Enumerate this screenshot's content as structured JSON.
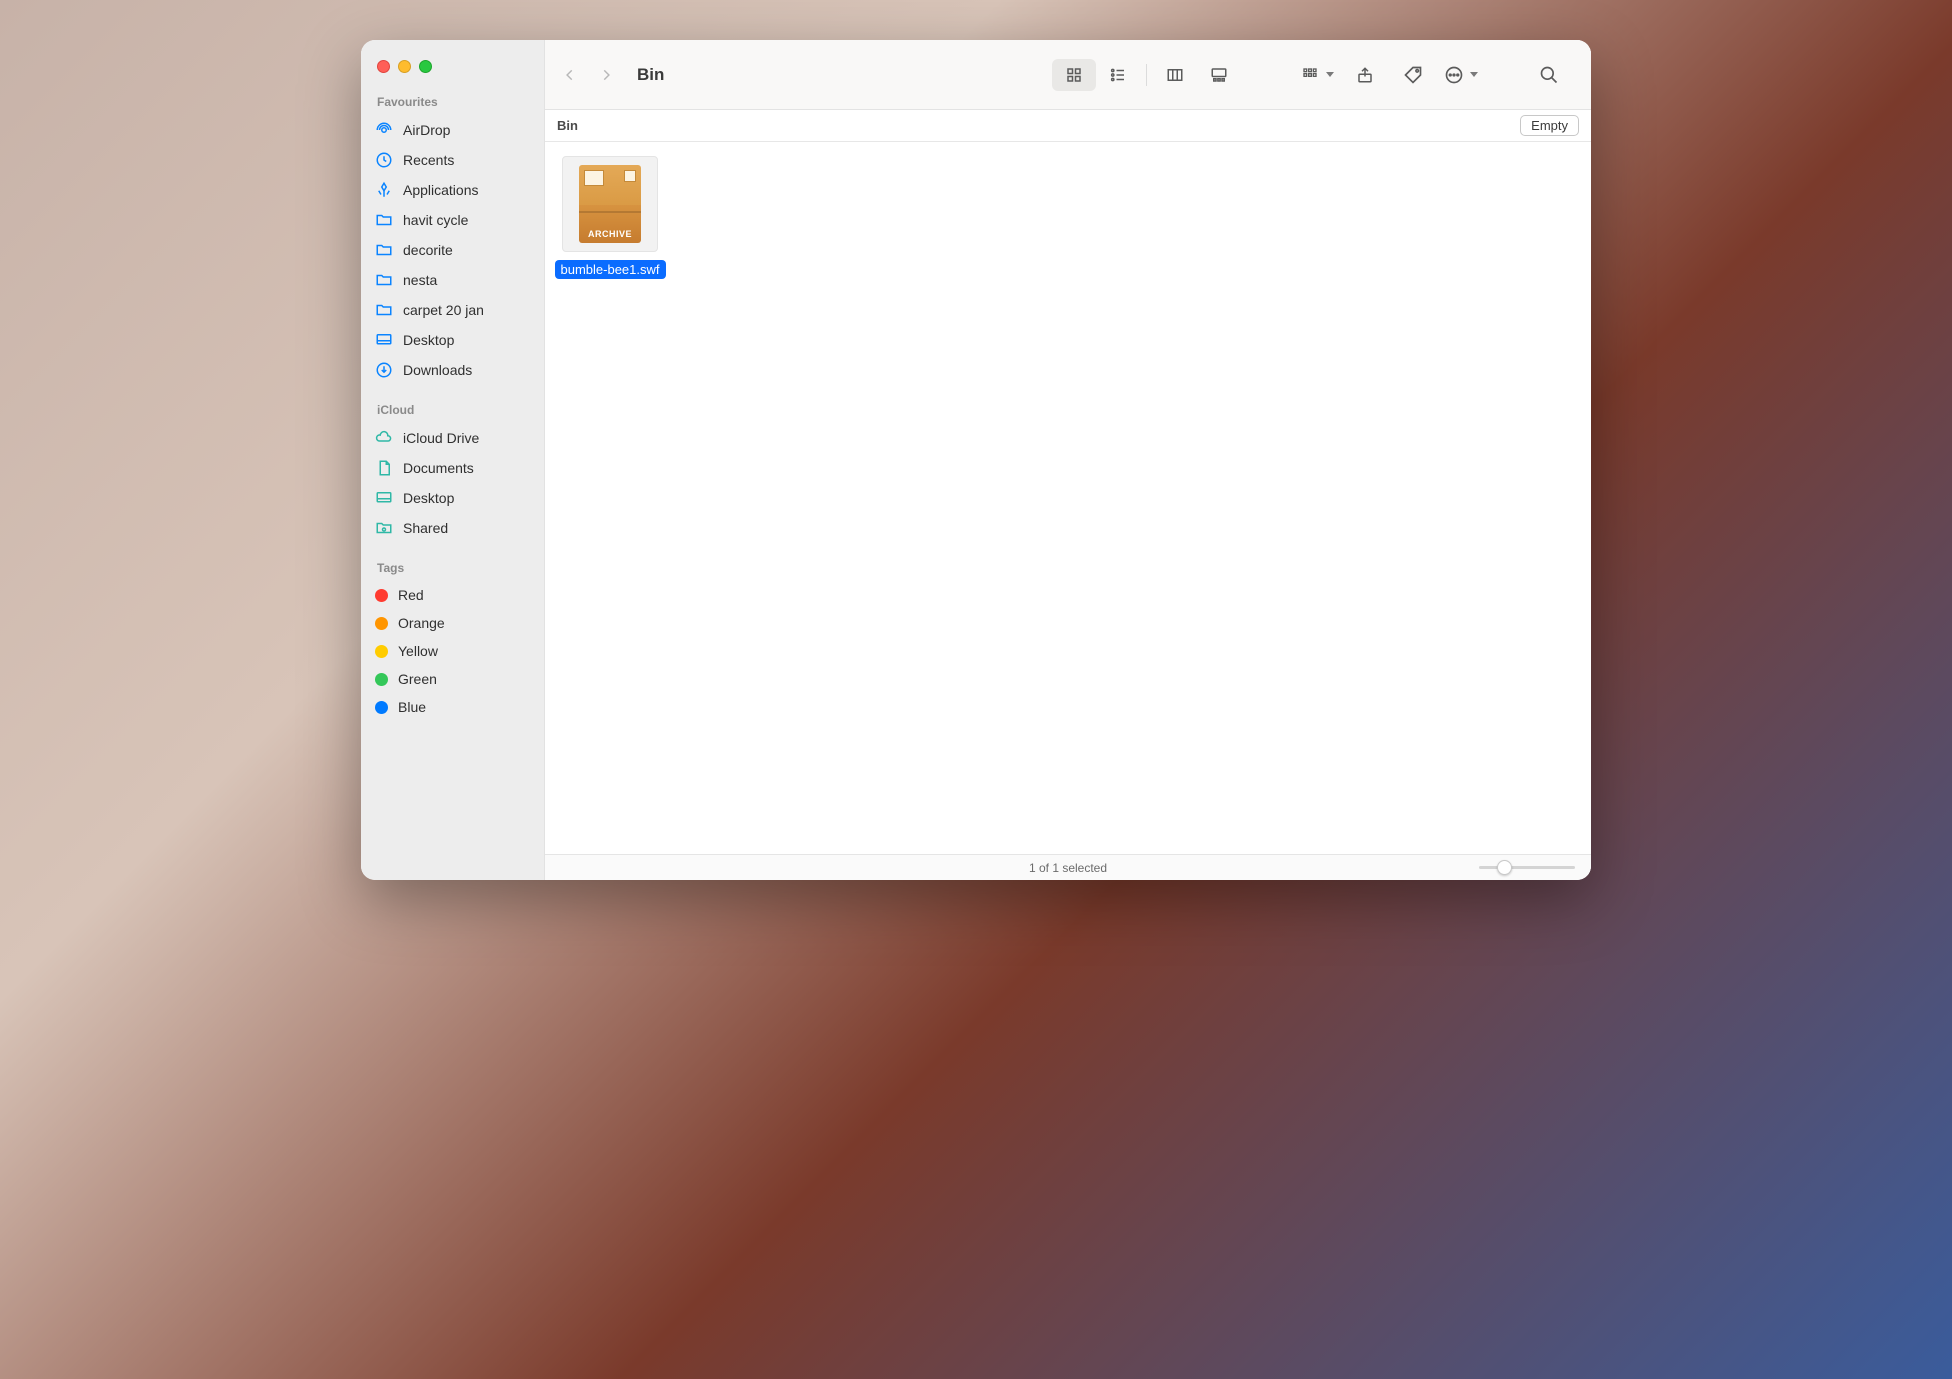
{
  "window_title": "Bin",
  "pathbar": {
    "location": "Bin",
    "empty_label": "Empty"
  },
  "sidebar": {
    "sections": [
      {
        "title": "Favourites",
        "items": [
          {
            "icon": "airdrop",
            "label": "AirDrop"
          },
          {
            "icon": "recents",
            "label": "Recents"
          },
          {
            "icon": "applications",
            "label": "Applications"
          },
          {
            "icon": "folder",
            "label": "havit cycle"
          },
          {
            "icon": "folder",
            "label": "decorite"
          },
          {
            "icon": "folder",
            "label": "nesta"
          },
          {
            "icon": "folder",
            "label": "carpet 20 jan"
          },
          {
            "icon": "desktop",
            "label": "Desktop"
          },
          {
            "icon": "downloads",
            "label": "Downloads"
          }
        ]
      },
      {
        "title": "iCloud",
        "teal": true,
        "items": [
          {
            "icon": "cloud",
            "label": "iCloud Drive"
          },
          {
            "icon": "document",
            "label": "Documents"
          },
          {
            "icon": "desktop",
            "label": "Desktop"
          },
          {
            "icon": "shared",
            "label": "Shared"
          }
        ]
      },
      {
        "title": "Tags",
        "items": [
          {
            "icon": "tag",
            "color": "#ff3b30",
            "label": "Red"
          },
          {
            "icon": "tag",
            "color": "#ff9500",
            "label": "Orange"
          },
          {
            "icon": "tag",
            "color": "#ffcc00",
            "label": "Yellow"
          },
          {
            "icon": "tag",
            "color": "#34c759",
            "label": "Green"
          },
          {
            "icon": "tag",
            "color": "#007aff",
            "label": "Blue"
          }
        ]
      }
    ]
  },
  "files": [
    {
      "name": "bumble-bee1.swf",
      "archive_badge": "ARCHIVE",
      "selected": true
    }
  ],
  "status": {
    "text": "1 of 1 selected"
  }
}
